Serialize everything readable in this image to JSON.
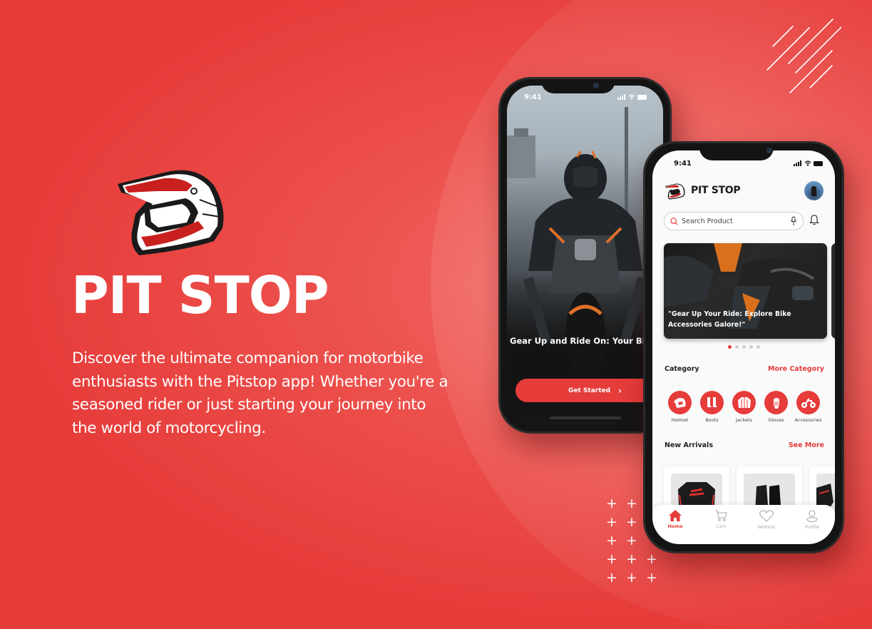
{
  "hero": {
    "title": "PIT STOP",
    "description": "Discover the ultimate companion for motorbike enthusiasts with the Pitstop app! Whether you're a seasoned rider or just starting your journey into the world of motorcycling."
  },
  "colors": {
    "brand": "#e63c3a",
    "dark": "#141414",
    "white": "#ffffff"
  },
  "onboarding": {
    "status_time": "9:41",
    "tagline": "Gear Up and Ride On: Your Bike Accessories Destination!",
    "cta_label": "Get Started",
    "cta_icon": "chevron-right-icon"
  },
  "home": {
    "status_time": "9:41",
    "brand": "PIT STOP",
    "search": {
      "placeholder": "Search Product"
    },
    "banner": {
      "text": "\"Gear Up Your Ride: Explore Bike Accessories Galore!\"",
      "slides": 5,
      "active_slide": 1
    },
    "category": {
      "title": "Category",
      "link": "More Category",
      "items": [
        {
          "label": "Helmet",
          "icon": "helmet-icon"
        },
        {
          "label": "Boots",
          "icon": "boots-icon"
        },
        {
          "label": "Jackets",
          "icon": "jacket-icon"
        },
        {
          "label": "Gloves",
          "icon": "gloves-icon"
        },
        {
          "label": "Accessories",
          "icon": "motorbike-icon"
        }
      ]
    },
    "arrivals": {
      "title": "New Arrivals",
      "link": "See More",
      "items": [
        {
          "product": "Racing jacket"
        },
        {
          "product": "Riding boots"
        },
        {
          "product": "Accessory"
        }
      ]
    },
    "nav": [
      {
        "label": "Home",
        "icon": "home-icon",
        "active": true
      },
      {
        "label": "Cart",
        "icon": "cart-icon",
        "active": false
      },
      {
        "label": "Wishlist",
        "icon": "heart-icon",
        "active": false
      },
      {
        "label": "Profile",
        "icon": "profile-icon",
        "active": false
      }
    ]
  }
}
